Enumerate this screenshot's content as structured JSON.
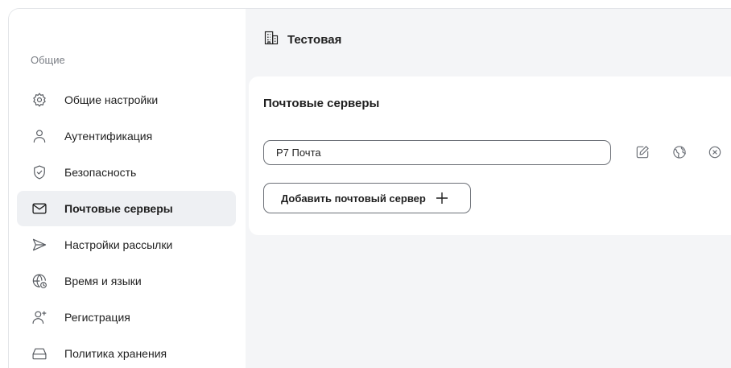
{
  "sidebar": {
    "section_label": "Общие",
    "items": [
      {
        "label": "Общие настройки",
        "icon": "gear-icon",
        "active": false
      },
      {
        "label": "Аутентификация",
        "icon": "user-icon",
        "active": false
      },
      {
        "label": "Безопасность",
        "icon": "shield-check-icon",
        "active": false
      },
      {
        "label": "Почтовые серверы",
        "icon": "mail-icon",
        "active": true
      },
      {
        "label": "Настройки рассылки",
        "icon": "send-icon",
        "active": false
      },
      {
        "label": "Время и языки",
        "icon": "globe-clock-icon",
        "active": false
      },
      {
        "label": "Регистрация",
        "icon": "user-plus-icon",
        "active": false
      },
      {
        "label": "Политика хранения",
        "icon": "storage-icon",
        "active": false
      }
    ]
  },
  "header": {
    "org_icon": "building-icon",
    "org_name": "Тестовая"
  },
  "card": {
    "title": "Почтовые серверы",
    "server": {
      "value": "Р7 Почта",
      "actions": [
        "edit-icon",
        "globe-icon",
        "close-circle-icon"
      ]
    },
    "add_button_label": "Добавить почтовый сервер",
    "add_button_icon": "plus-icon"
  },
  "colors": {
    "active_bg": "#eef0f3",
    "main_bg": "#f4f5f7",
    "text": "#1f1f1f",
    "muted": "#7b7f86",
    "border": "#6c7077"
  }
}
